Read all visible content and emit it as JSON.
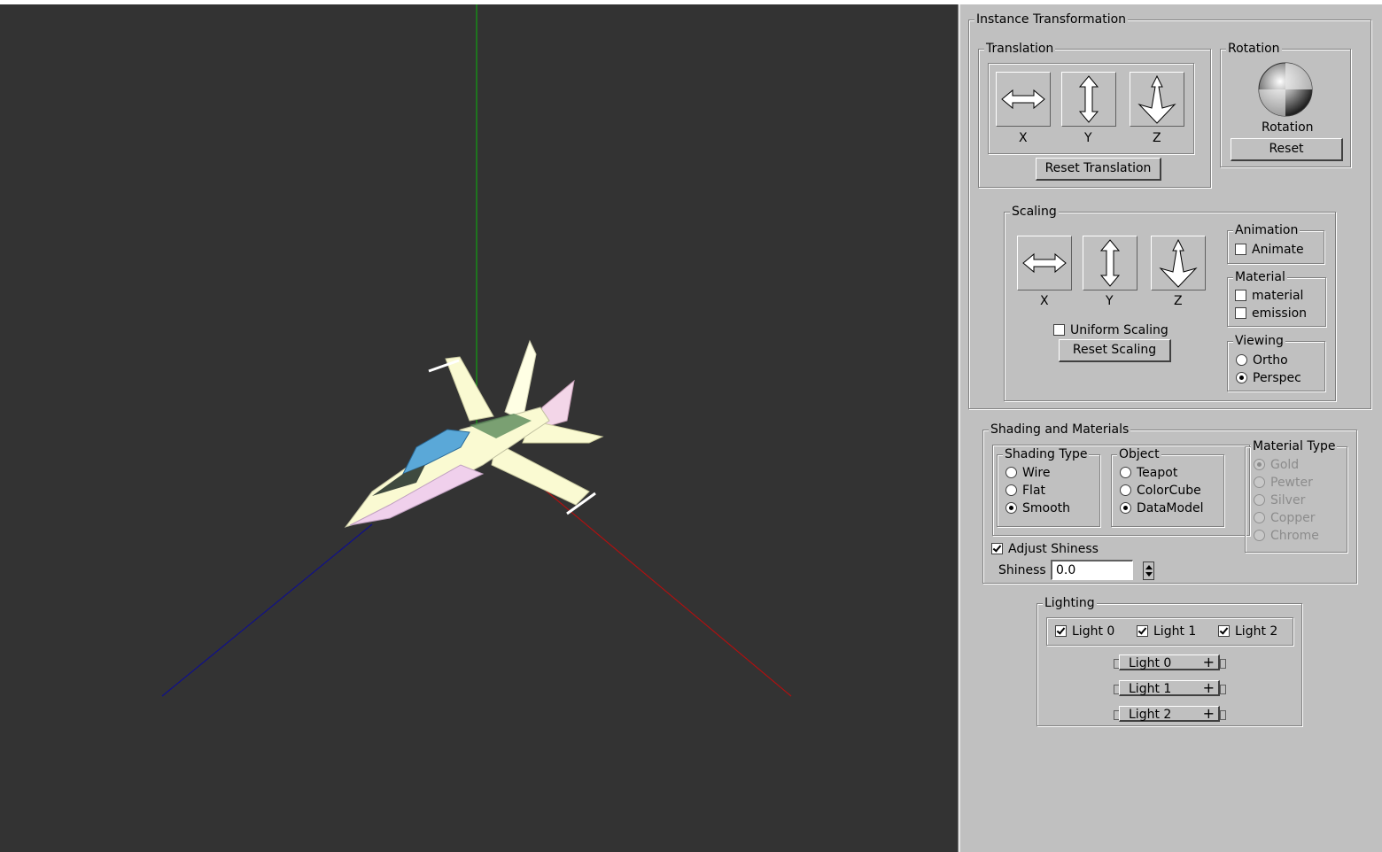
{
  "panel": {
    "instance_transformation": {
      "title": "Instance Transformation",
      "translation": {
        "title": "Translation",
        "x": "X",
        "y": "Y",
        "z": "Z",
        "reset": "Reset Translation"
      },
      "rotation": {
        "title": "Rotation",
        "label": "Rotation",
        "reset": "Reset"
      },
      "scaling": {
        "title": "Scaling",
        "x": "X",
        "y": "Y",
        "z": "Z",
        "uniform": "Uniform Scaling",
        "uniform_checked": false,
        "reset": "Reset Scaling"
      },
      "animation": {
        "title": "Animation",
        "animate": "Animate",
        "animate_checked": false
      },
      "material": {
        "title": "Material",
        "material": "material",
        "emission": "emission"
      },
      "viewing": {
        "title": "Viewing",
        "ortho": "Ortho",
        "perspec": "Perspec",
        "selected": "Perspec"
      }
    },
    "shading_materials": {
      "title": "Shading and Materials",
      "shading_type": {
        "title": "Shading Type",
        "options": [
          "Wire",
          "Flat",
          "Smooth"
        ],
        "selected": "Smooth"
      },
      "object": {
        "title": "Object",
        "options": [
          "Teapot",
          "ColorCube",
          "DataModel"
        ],
        "selected": "DataModel"
      },
      "material_type": {
        "title": "Material Type",
        "options": [
          "Gold",
          "Pewter",
          "Silver",
          "Copper",
          "Chrome"
        ],
        "selected": "Gold",
        "enabled": false
      },
      "adjust_shiness": "Adjust Shiness",
      "adjust_shiness_checked": true,
      "shiness_label": "Shiness",
      "shiness_value": "0.0"
    },
    "lighting": {
      "title": "Lighting",
      "lights": [
        "Light 0",
        "Light 1",
        "Light 2"
      ],
      "rollouts": [
        "Light 0",
        "Light 1",
        "Light 2"
      ],
      "rollout_icon": "+"
    }
  },
  "viewport": {
    "axis_colors": {
      "x": "#b01010",
      "y": "#10a010",
      "z": "#10108a"
    },
    "background": "#333333",
    "model": "jet-aircraft"
  }
}
